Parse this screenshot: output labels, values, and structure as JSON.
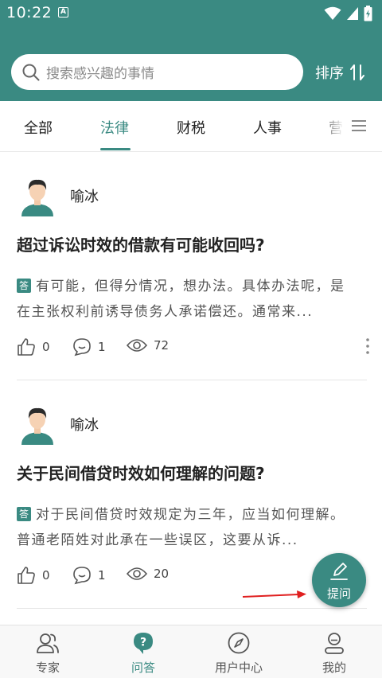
{
  "status": {
    "time": "10:22",
    "a_badge": "A"
  },
  "search": {
    "placeholder": "搜索感兴趣的事情"
  },
  "sort": {
    "label": "排序"
  },
  "tabs": [
    {
      "label": "全部"
    },
    {
      "label": "法律",
      "active": true
    },
    {
      "label": "财税"
    },
    {
      "label": "人事"
    },
    {
      "label": "营"
    }
  ],
  "posts": [
    {
      "author": "喻冰",
      "title": "超过诉讼时效的借款有可能收回吗?",
      "answer_badge": "答",
      "answer": "有可能，但得分情况，想办法。具体办法呢，是在主张权利前诱导债务人承诺偿还。通常来...",
      "likes": "0",
      "comments": "1",
      "views": "72"
    },
    {
      "author": "喻冰",
      "title": "关于民间借贷时效如何理解的问题?",
      "answer_badge": "答",
      "answer": "对于民间借贷时效规定为三年，应当如何理解。普通老陌姓对此承在一些误区，这要从诉...",
      "likes": "0",
      "comments": "1",
      "views": "20"
    }
  ],
  "fab": {
    "label": "提问"
  },
  "bottom_nav": [
    {
      "label": "专家",
      "icon": "experts-icon"
    },
    {
      "label": "问答",
      "icon": "qa-icon",
      "active": true
    },
    {
      "label": "用户中心",
      "icon": "compass-icon"
    },
    {
      "label": "我的",
      "icon": "profile-icon"
    }
  ],
  "colors": {
    "primary": "#3a8a82",
    "annotation_arrow": "#e02020"
  }
}
